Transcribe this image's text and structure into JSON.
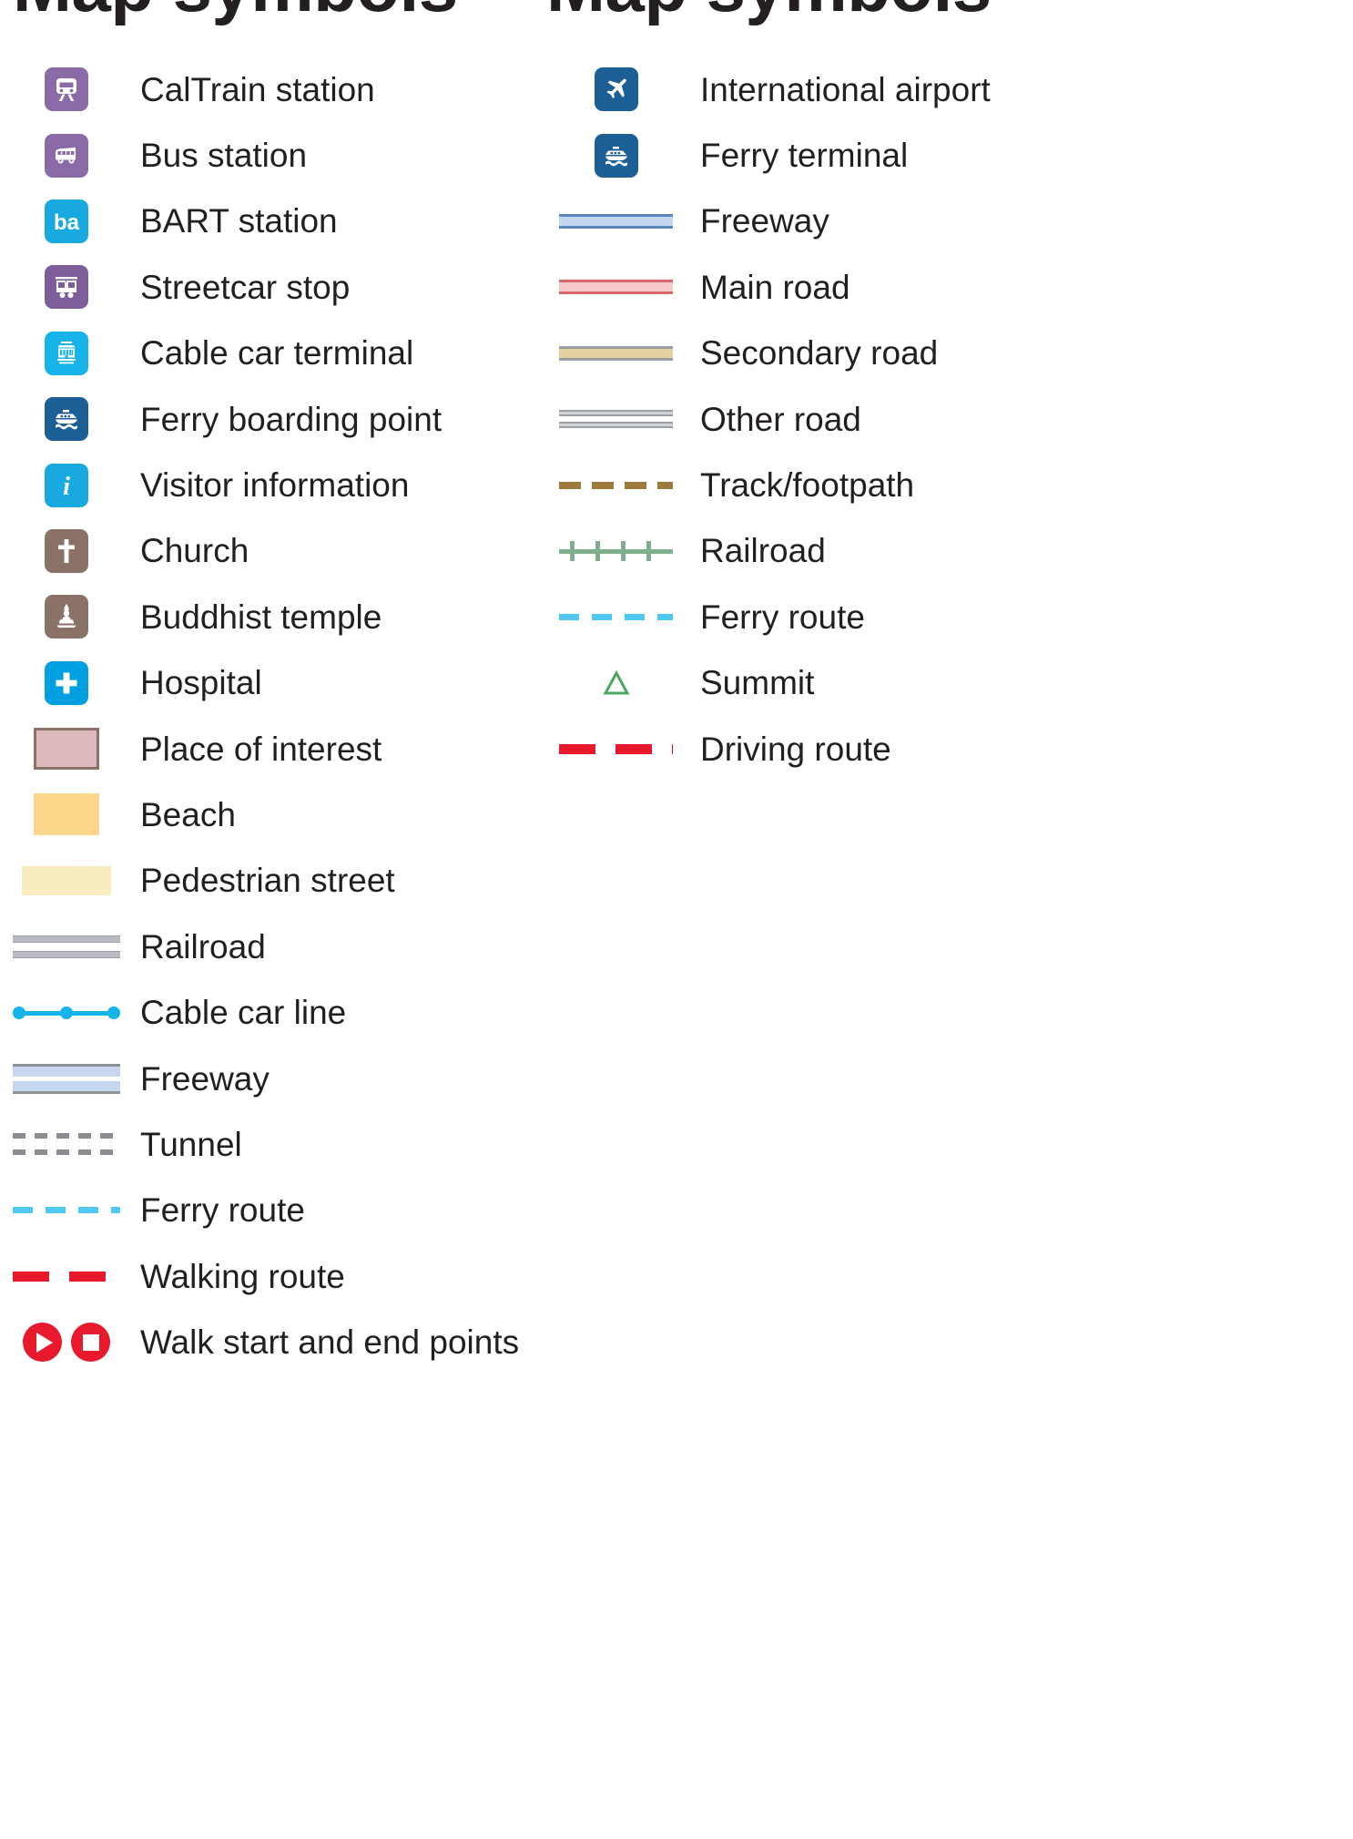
{
  "legend": {
    "left": {
      "title": "Map symbols",
      "items": [
        {
          "label": "CalTrain station",
          "sample": "icon-caltrain",
          "color": "#8a6ba8"
        },
        {
          "label": "Bus station",
          "sample": "icon-bus",
          "color": "#8a6ba8"
        },
        {
          "label": "BART station",
          "sample": "icon-bart",
          "color": "#17a9e0"
        },
        {
          "label": "Streetcar stop",
          "sample": "icon-streetcar",
          "color": "#7d5e9b"
        },
        {
          "label": "Cable car terminal",
          "sample": "icon-cablecar",
          "color": "#17b4ea"
        },
        {
          "label": "Ferry boarding point",
          "sample": "icon-ferry",
          "color": "#1c5e96"
        },
        {
          "label": "Visitor information",
          "sample": "icon-information",
          "color": "#17a9e0"
        },
        {
          "label": "Church",
          "sample": "icon-church",
          "color": "#8a7268"
        },
        {
          "label": "Buddhist temple",
          "sample": "icon-temple",
          "color": "#8a7268"
        },
        {
          "label": "Hospital",
          "sample": "icon-hospital",
          "color": "#00a0e0"
        },
        {
          "label": "Place of interest",
          "sample": "swatch-poi",
          "color": "#dbb9ba"
        },
        {
          "label": "Beach",
          "sample": "swatch-beach",
          "color": "#fcd68a"
        },
        {
          "label": "Pedestrian street",
          "sample": "swatch-pedestrian",
          "color": "#f8ecc0"
        },
        {
          "label": "Railroad",
          "sample": "line-railroad-gray",
          "color": "#b9bcc0"
        },
        {
          "label": "Cable car line",
          "sample": "line-cablecar",
          "color": "#16b4e8"
        },
        {
          "label": "Freeway",
          "sample": "line-freeway-left",
          "color": "#c6d6ee"
        },
        {
          "label": "Tunnel",
          "sample": "line-tunnel",
          "color": "#8b8e93"
        },
        {
          "label": "Ferry route",
          "sample": "line-ferry-route",
          "color": "#4fc8f2"
        },
        {
          "label": "Walking route",
          "sample": "line-walking-route",
          "color": "#e8192c"
        },
        {
          "label": "Walk start and end points",
          "sample": "marker-walk-points",
          "color": "#e8192c"
        }
      ]
    },
    "right": {
      "title": "Map symbols",
      "items": [
        {
          "label": "International airport",
          "sample": "icon-airport",
          "color": "#1c5e96"
        },
        {
          "label": "Ferry terminal",
          "sample": "icon-ferry-terminal",
          "color": "#1c5e96"
        },
        {
          "label": "Freeway",
          "sample": "road-freeway",
          "color": "#c3d6ef"
        },
        {
          "label": "Main road",
          "sample": "road-main",
          "color": "#f6c9ca"
        },
        {
          "label": "Secondary road",
          "sample": "road-secondary",
          "color": "#e4d1a0"
        },
        {
          "label": "Other road",
          "sample": "road-other",
          "color": "#cfd2d6"
        },
        {
          "label": "Track/footpath",
          "sample": "line-track-footpath",
          "color": "#9d7a3b"
        },
        {
          "label": "Railroad",
          "sample": "line-railroad-green",
          "color": "#7fae8d"
        },
        {
          "label": "Ferry route",
          "sample": "line-ferry-route",
          "color": "#4fc8f2"
        },
        {
          "label": "Summit",
          "sample": "marker-summit",
          "color": "#4aa863"
        },
        {
          "label": "Driving route",
          "sample": "line-driving-route",
          "color": "#e8192c"
        }
      ]
    }
  }
}
